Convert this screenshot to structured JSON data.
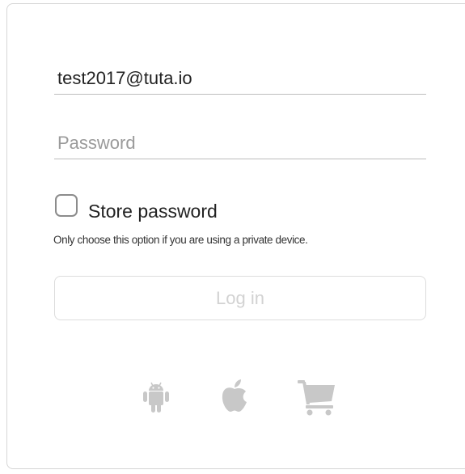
{
  "login": {
    "email_value": "test2017@tuta.io",
    "password_placeholder": "Password",
    "password_value": "",
    "store_password_label": "Store password",
    "store_password_checked": false,
    "store_password_hint": "Only choose this option if you are using a private device.",
    "login_button_label": "Log in"
  },
  "store_links": [
    {
      "icon": "android-icon"
    },
    {
      "icon": "apple-icon"
    },
    {
      "icon": "cart-icon"
    }
  ],
  "colors": {
    "icon_gray": "#c8c8c8",
    "button_text_disabled": "#d2d2d2",
    "border": "#d6d6d6"
  }
}
